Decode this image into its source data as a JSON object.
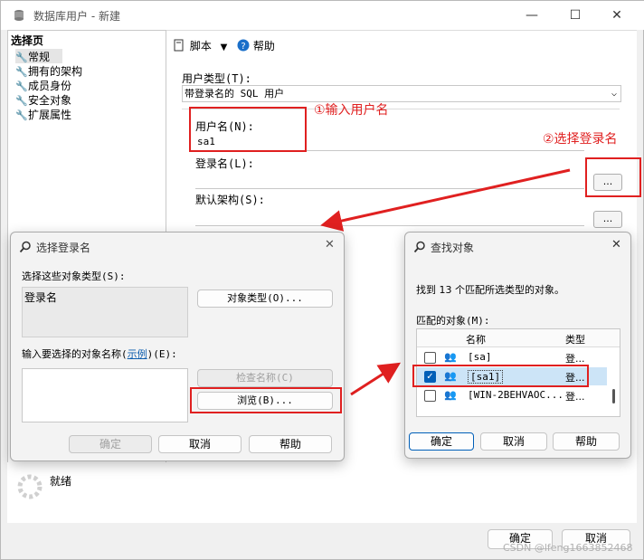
{
  "window": {
    "title": "数据库用户 - 新建",
    "minimize": "—",
    "maximize": "☐",
    "close": "✕"
  },
  "left_pane": {
    "header": "选择页",
    "items": [
      "常规",
      "拥有的架构",
      "成员身份",
      "安全对象",
      "扩展属性"
    ],
    "status": "就绪"
  },
  "toolbar": {
    "script": "脚本",
    "help": "帮助"
  },
  "form": {
    "user_type_label": "用户类型(T):",
    "user_type_value": "带登录名的 SQL 用户",
    "username_label": "用户名(N):",
    "username_value": "sa1",
    "login_label": "登录名(L):",
    "login_value": "",
    "schema_label": "默认架构(S):",
    "schema_value": "",
    "browse_btn": "..."
  },
  "annotations": {
    "step1": "①输入用户名",
    "step2": "②选择登录名"
  },
  "select_login_dialog": {
    "title": "选择登录名",
    "object_types_label": "选择这些对象类型(S):",
    "object_type_value": "登录名",
    "object_types_btn": "对象类型(O)...",
    "names_label_pre": "输入要选择的对象名称(",
    "names_label_link": "示例",
    "names_label_post": ")(E):",
    "check_names_btn": "检查名称(C)",
    "browse_btn": "浏览(B)...",
    "ok": "确定",
    "cancel": "取消",
    "help": "帮助"
  },
  "find_objects_dialog": {
    "title": "查找对象",
    "found_text": "找到 13 个匹配所选类型的对象。",
    "matched_label": "匹配的对象(M):",
    "col_name": "名称",
    "col_type": "类型",
    "rows": [
      {
        "name": "[sa]",
        "type": "登...",
        "checked": false
      },
      {
        "name": "[sa1]",
        "type": "登...",
        "checked": true
      },
      {
        "name": "[WIN-2BEHVAOC...",
        "type": "登...",
        "checked": false
      }
    ],
    "ok": "确定",
    "cancel": "取消",
    "help": "帮助"
  },
  "footer": {
    "ok": "确定",
    "cancel": "取消",
    "watermark": "CSDN @lfeng1663852468"
  },
  "colors": {
    "accent": "#005fb8",
    "annotation": "#e02020"
  }
}
